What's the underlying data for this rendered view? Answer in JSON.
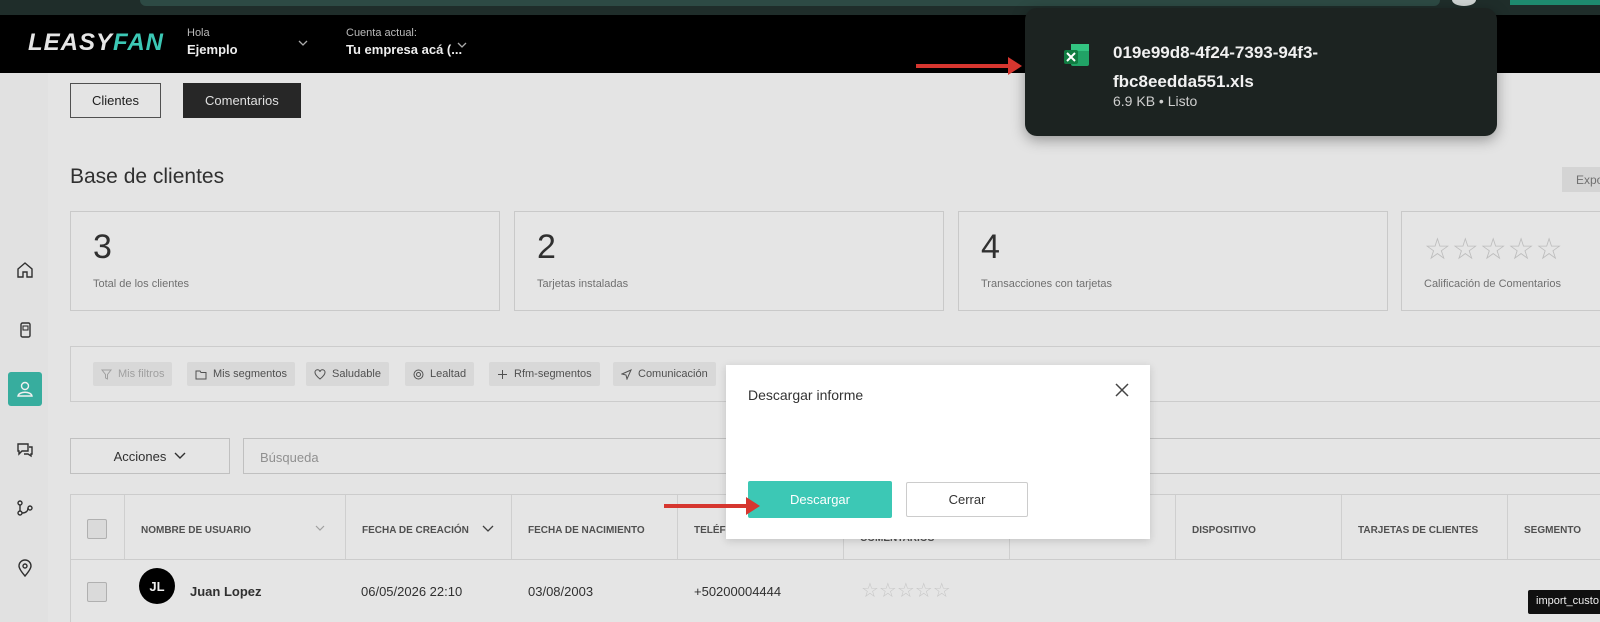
{
  "header": {
    "logo_leasy": "LEASY",
    "logo_fan": "FAN",
    "greeting_small": "Hola",
    "greeting_name": "Ejemplo",
    "account_small": "Cuenta actual:",
    "account_name": "Tu empresa acá (..."
  },
  "tabs": [
    {
      "label": "Clientes"
    },
    {
      "label": "Comentarios"
    }
  ],
  "page": {
    "title": "Base de clientes",
    "export_label": "Expo"
  },
  "stats": [
    {
      "value": "3",
      "label": "Total de los clientes"
    },
    {
      "value": "2",
      "label": "Tarjetas instaladas"
    },
    {
      "value": "4",
      "label": "Transacciones con tarjetas"
    },
    {
      "stars": "☆☆☆☆☆",
      "label": "Calificación de Comentarios"
    }
  ],
  "filters": [
    {
      "label": "Mis filtros",
      "icon": "funnel-icon"
    },
    {
      "label": "Mis segmentos",
      "icon": "folder-icon"
    },
    {
      "label": "Saludable",
      "icon": "heart-icon"
    },
    {
      "label": "Lealtad",
      "icon": "loyalty-icon"
    },
    {
      "label": "Rfm-segmentos",
      "icon": "move-icon"
    },
    {
      "label": "Comunicación",
      "icon": "send-icon"
    }
  ],
  "toolbar": {
    "actions_label": "Acciones",
    "search_placeholder": "Búsqueda"
  },
  "table": {
    "columns": [
      "NOMBRE DE USUARIO",
      "FECHA DE CREACIÓN",
      "FECHA DE NACIMIENTO",
      "TELÉF",
      "COMENTARIOS",
      "",
      "DISPOSITIVO",
      "TARJETAS DE CLIENTES",
      "SEGMENTO"
    ],
    "rows": [
      {
        "initials": "JL",
        "name": "Juan Lopez",
        "created": "06/05/2026 22:10",
        "birth": "03/08/2003",
        "phone": "+50200004444",
        "rating_stars": "☆☆☆☆☆",
        "segment": "import_custo"
      }
    ]
  },
  "modal": {
    "title": "Descargar informe",
    "download_label": "Descargar",
    "close_label": "Cerrar"
  },
  "download": {
    "filename": "019e99d8-4f24-7393-94f3-fbc8eedda551.xls",
    "meta": "6.9 KB • Listo"
  },
  "colors": {
    "accent": "#3cc8b5",
    "header_bg": "#000000",
    "annotation_red": "#d6362f",
    "popup_bg": "#1c2321"
  }
}
